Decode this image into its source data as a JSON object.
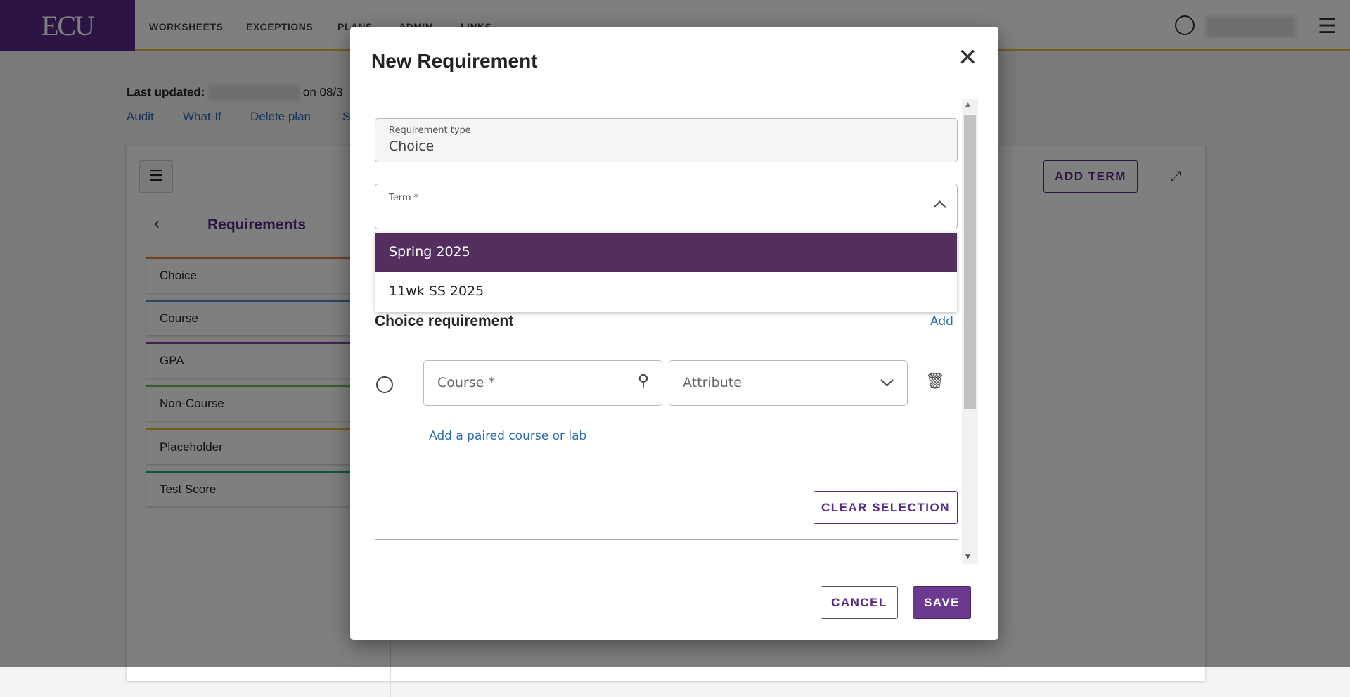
{
  "header": {
    "logo": "ECU",
    "nav": [
      "WORKSHEETS",
      "EXCEPTIONS",
      "PLANS",
      "ADMIN",
      "LINKS"
    ]
  },
  "page": {
    "last_updated_label": "Last updated:",
    "last_updated_suffix": "on 08/3",
    "links": [
      "Audit",
      "What-If",
      "Delete plan",
      "Sa"
    ]
  },
  "panel": {
    "title": "Requirements",
    "add_term": "ADD TERM",
    "items": [
      {
        "label": "Choice",
        "color": "#e8833a"
      },
      {
        "label": "Course",
        "color": "#4a8fd6"
      },
      {
        "label": "GPA",
        "color": "#8e3fa8"
      },
      {
        "label": "Non-Course",
        "color": "#6abf4b"
      },
      {
        "label": "Placeholder",
        "color": "#f2b632"
      },
      {
        "label": "Test Score",
        "color": "#1fa88a"
      }
    ]
  },
  "modal": {
    "title": "New Requirement",
    "requirement_type": {
      "label": "Requirement type",
      "value": "Choice"
    },
    "term": {
      "label": "Term *",
      "value": "",
      "options": [
        "Spring 2025",
        "11wk SS 2025"
      ],
      "highlighted": "Spring 2025"
    },
    "choice_heading": "Choice requirement",
    "add": "Add",
    "course_placeholder": "Course *",
    "attribute_placeholder": "Attribute",
    "paired_link": "Add a paired course or lab",
    "clear": "CLEAR SELECTION",
    "cancel": "CANCEL",
    "save": "SAVE"
  },
  "colors": {
    "brand": "#592a8a",
    "highlight": "#532e5f",
    "gold": "#f2b632",
    "link": "#2a6bb0"
  }
}
